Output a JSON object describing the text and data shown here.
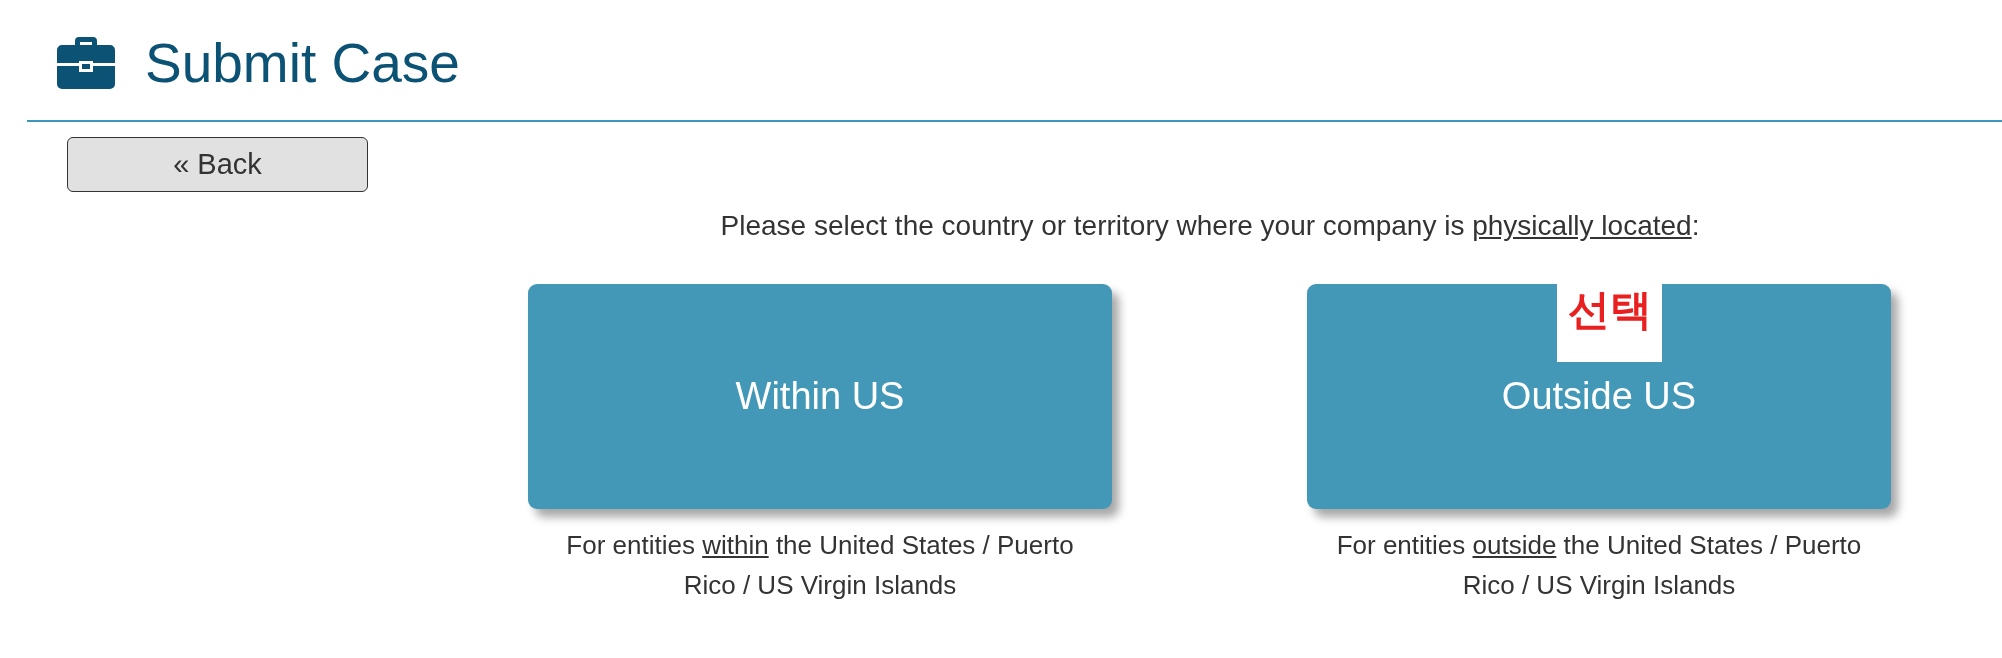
{
  "header": {
    "title": "Submit Case"
  },
  "back_button": {
    "label": "« Back"
  },
  "prompt": {
    "parts": [
      {
        "text": "Please select the country or territory where your company is ",
        "underlined": false
      },
      {
        "text": "physically located",
        "underlined": true
      },
      {
        "text": ":",
        "underlined": false
      }
    ]
  },
  "options": [
    {
      "label": "Within US",
      "description": [
        {
          "text": "For entities ",
          "underlined": false
        },
        {
          "text": "within",
          "underlined": true
        },
        {
          "text": " the United States / Puerto Rico / US Virgin Islands",
          "underlined": false
        }
      ]
    },
    {
      "label": "Outside US",
      "annotation": "선택",
      "description": [
        {
          "text": "For entities ",
          "underlined": false
        },
        {
          "text": "outside",
          "underlined": true
        },
        {
          "text": " the United States / Puerto Rico / US Virgin Islands",
          "underlined": false
        }
      ]
    }
  ]
}
